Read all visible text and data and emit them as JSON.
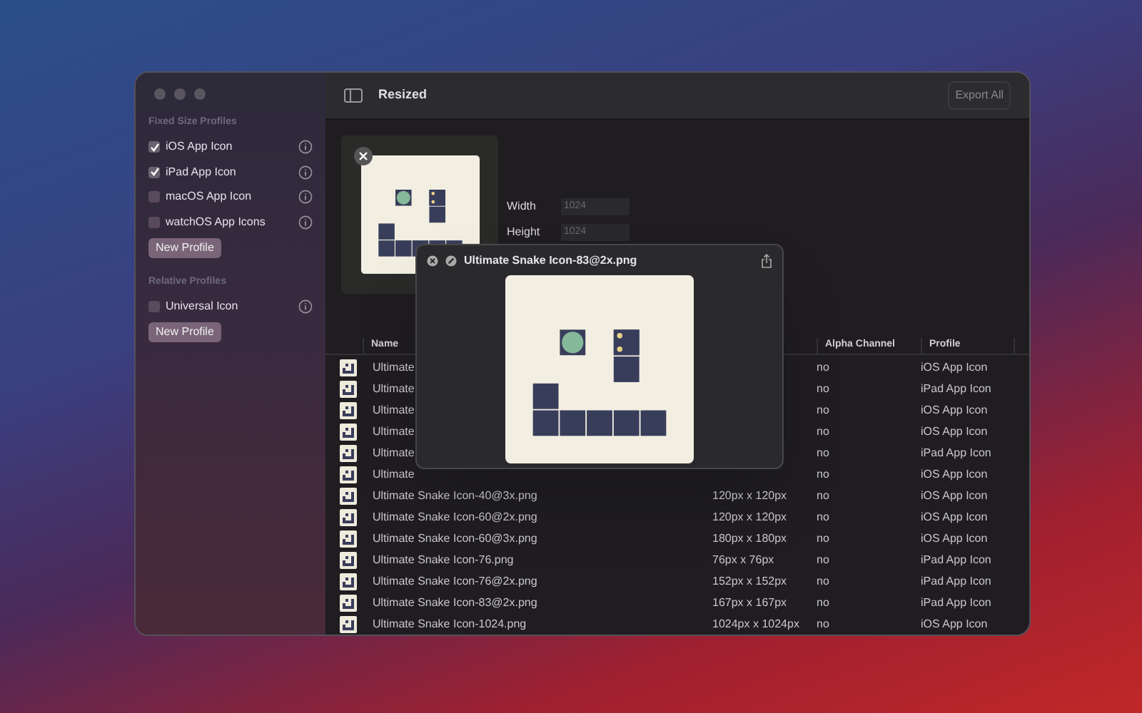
{
  "window": {
    "title": "Resized",
    "export_button": "Export All"
  },
  "sidebar": {
    "sections": [
      {
        "title": "Fixed Size Profiles",
        "items": [
          {
            "label": "iOS App Icon",
            "checked": true
          },
          {
            "label": "iPad App Icon",
            "checked": true
          },
          {
            "label": "macOS App Icon",
            "checked": false
          },
          {
            "label": "watchOS App Icons",
            "checked": false
          }
        ],
        "button": "New Profile"
      },
      {
        "title": "Relative Profiles",
        "items": [
          {
            "label": "Universal Icon",
            "checked": false
          }
        ],
        "button": "New Profile"
      }
    ]
  },
  "source": {
    "width_label": "Width",
    "width_value": "1024",
    "height_label": "Height",
    "height_value": "1024"
  },
  "popover": {
    "title": "Ultimate Snake Icon-83@2x.png"
  },
  "table": {
    "columns": [
      "Name",
      "Alpha Channel",
      "Profile"
    ],
    "rows": [
      {
        "name": "Ultimate",
        "alpha": "no",
        "profile": "iOS App Icon"
      },
      {
        "name": "Ultimate",
        "alpha": "no",
        "profile": "iPad App Icon"
      },
      {
        "name": "Ultimate",
        "alpha": "no",
        "profile": "iOS App Icon"
      },
      {
        "name": "Ultimate",
        "alpha": "no",
        "profile": "iOS App Icon"
      },
      {
        "name": "Ultimate",
        "alpha": "no",
        "profile": "iPad App Icon"
      },
      {
        "name": "Ultimate",
        "alpha": "no",
        "profile": "iOS App Icon"
      },
      {
        "name": "Ultimate Snake Icon-40@3x.png",
        "size": "120px x 120px",
        "alpha": "no",
        "profile": "iOS App Icon"
      },
      {
        "name": "Ultimate Snake Icon-60@2x.png",
        "size": "120px x 120px",
        "alpha": "no",
        "profile": "iOS App Icon"
      },
      {
        "name": "Ultimate Snake Icon-60@3x.png",
        "size": "180px x 180px",
        "alpha": "no",
        "profile": "iOS App Icon"
      },
      {
        "name": "Ultimate Snake Icon-76.png",
        "size": "76px x 76px",
        "alpha": "no",
        "profile": "iPad App Icon"
      },
      {
        "name": "Ultimate Snake Icon-76@2x.png",
        "size": "152px x 152px",
        "alpha": "no",
        "profile": "iPad App Icon"
      },
      {
        "name": "Ultimate Snake Icon-83@2x.png",
        "size": "167px x 167px",
        "alpha": "no",
        "profile": "iPad App Icon"
      },
      {
        "name": "Ultimate Snake Icon-1024.png",
        "size": "1024px x 1024px",
        "alpha": "no",
        "profile": "iOS App Icon"
      }
    ]
  }
}
